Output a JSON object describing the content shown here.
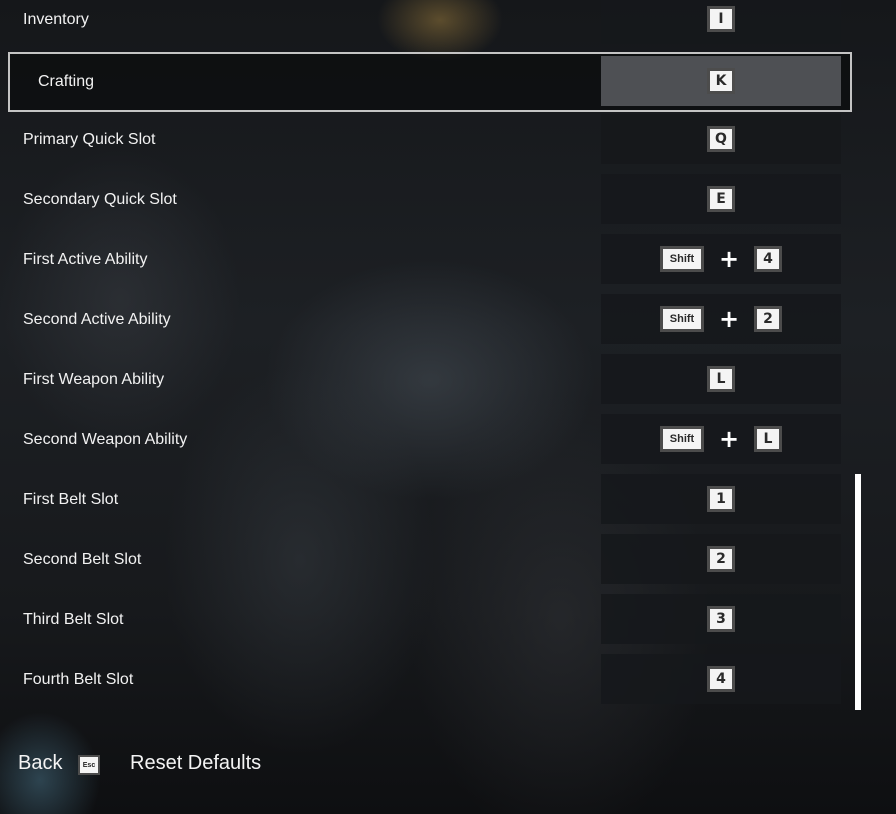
{
  "keybinds": [
    {
      "action": "Inventory",
      "keys": [
        "I"
      ]
    },
    {
      "action": "Crafting",
      "keys": [
        "K"
      ],
      "selected": true
    },
    {
      "action": "Primary Quick Slot",
      "keys": [
        "Q"
      ]
    },
    {
      "action": "Secondary Quick Slot",
      "keys": [
        "E"
      ]
    },
    {
      "action": "First Active Ability",
      "keys": [
        "Shift",
        "4"
      ]
    },
    {
      "action": "Second Active Ability",
      "keys": [
        "Shift",
        "2"
      ]
    },
    {
      "action": "First Weapon Ability",
      "keys": [
        "L"
      ]
    },
    {
      "action": "Second Weapon Ability",
      "keys": [
        "Shift",
        "L"
      ]
    },
    {
      "action": "First Belt Slot",
      "keys": [
        "1"
      ]
    },
    {
      "action": "Second Belt Slot",
      "keys": [
        "2"
      ]
    },
    {
      "action": "Third Belt Slot",
      "keys": [
        "3"
      ]
    },
    {
      "action": "Fourth Belt Slot",
      "keys": [
        "4"
      ]
    }
  ],
  "key_combo_separator": "+",
  "footer": {
    "back_label": "Back",
    "back_key": "Esc",
    "reset_label": "Reset Defaults"
  },
  "colors": {
    "selected_outline": "#c4c4c4",
    "key_face": "#f4f4f4",
    "key_border": "#4c4c4c",
    "scrollbar": "#ffffff"
  }
}
